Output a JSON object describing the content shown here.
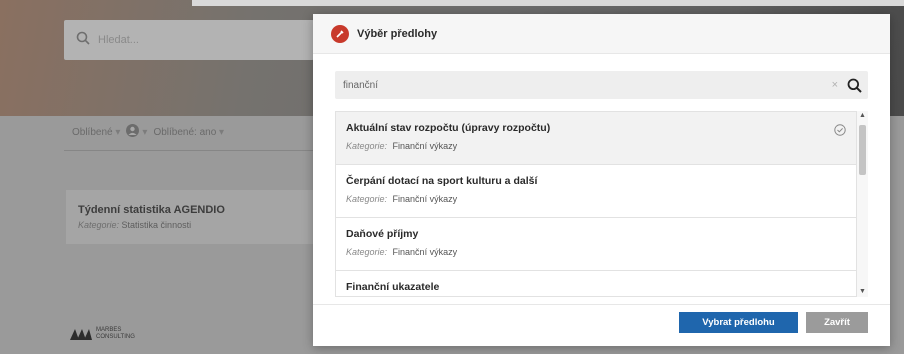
{
  "background": {
    "search_placeholder": "Hledat...",
    "filters": {
      "favorites_label": "Oblíbené",
      "favorites_filter": "Oblíbené: ano",
      "caret": "▾"
    },
    "card": {
      "title": "Týdenní statistika AGENDIO",
      "category_label": "Kategorie:",
      "category_value": "Statistika činnosti"
    },
    "logo": {
      "line1": "MARBES",
      "line2": "CONSULTING"
    }
  },
  "modal": {
    "title": "Výběr předlohy",
    "search": {
      "value": "finanční",
      "clear_glyph": "×"
    },
    "category_label": "Kategorie:",
    "items": [
      {
        "name": "Aktuální stav rozpočtu (úpravy rozpočtu)",
        "category": "Finanční výkazy",
        "selected": true
      },
      {
        "name": "Čerpání dotací na sport kulturu a další",
        "category": "Finanční výkazy",
        "selected": false
      },
      {
        "name": "Daňové příjmy",
        "category": "Finanční výkazy",
        "selected": false
      },
      {
        "name": "Finanční ukazatele",
        "category": "",
        "selected": false
      }
    ],
    "buttons": {
      "select": "Vybrat předlohu",
      "close": "Zavřít"
    }
  },
  "colors": {
    "accent": "#1f66ad",
    "badge": "#c8392b",
    "secondary_button": "#9b9b9b"
  },
  "icons": {
    "search": "search-icon",
    "clear": "clear-icon",
    "badge": "template-icon",
    "check": "check-circle-icon",
    "user": "user-icon"
  }
}
